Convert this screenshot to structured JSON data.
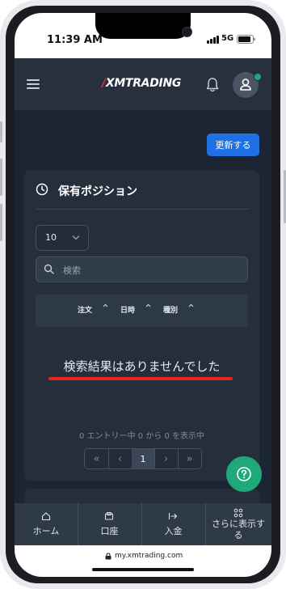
{
  "status_bar": {
    "time": "11:39 AM",
    "network": "5G"
  },
  "header": {
    "logo_mark": "∕",
    "logo_text": "XMTRADING"
  },
  "toolbar": {
    "refresh_label": "更新する"
  },
  "positions_card": {
    "title": "保有ポジション",
    "page_size": "10",
    "search_placeholder": "検索",
    "columns": [
      "注文",
      "日時",
      "種別"
    ],
    "empty_message": "検索結果はありませんでした",
    "entries_info": "0 エントリー中 0 から 0 を表示中",
    "pager": {
      "first": "«",
      "prev": "‹",
      "current": "1",
      "next": "›",
      "last": "»"
    }
  },
  "bottom_nav": {
    "items": [
      {
        "label": "ホーム",
        "icon": "home-icon"
      },
      {
        "label": "口座",
        "icon": "account-icon"
      },
      {
        "label": "入金",
        "icon": "deposit-icon"
      },
      {
        "label": "さらに表示する",
        "icon": "grid-icon"
      }
    ]
  },
  "browser": {
    "url": "my.xmtrading.com"
  },
  "colors": {
    "accent": "#1f6fe5",
    "brand_red": "#e4312b",
    "success": "#1fa97a",
    "underline": "#e6261f",
    "bg": "#1b2533",
    "card": "#252f3c"
  }
}
